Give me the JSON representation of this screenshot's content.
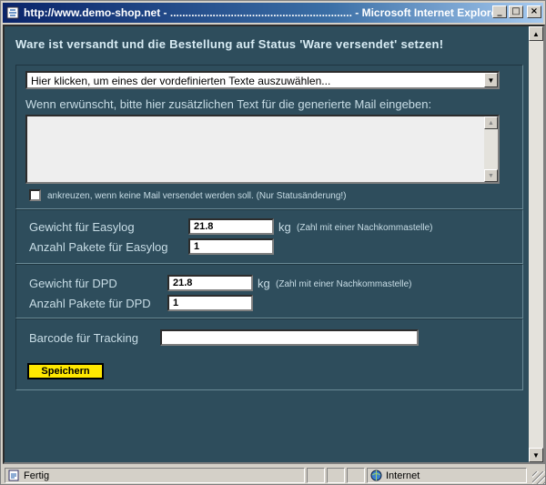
{
  "window": {
    "title": "http://www.demo-shop.net - ............................................................ - Microsoft Internet Explorer",
    "minimize": "_",
    "maximize": "□",
    "close": "×"
  },
  "page": {
    "heading": "Ware ist versandt und die Bestellung auf Status 'Ware versendet' setzen!",
    "template_select": "Hier klicken, um eines der vordefinierten Texte auszuwählen...",
    "extra_text_label": "Wenn erwünscht, bitte hier zusätzlichen Text für die generierte Mail eingeben:",
    "extra_text_value": "",
    "no_mail_label": "ankreuzen, wenn keine Mail versendet werden soll. (Nur Statusänderung!)",
    "no_mail_checked": false,
    "easylog": {
      "weight_label": "Gewicht für Easylog",
      "weight_value": "21.8",
      "unit": "kg",
      "unit_hint": "(Zahl mit einer Nachkommastelle)",
      "packages_label": "Anzahl Pakete für Easylog",
      "packages_value": "1"
    },
    "dpd": {
      "weight_label": "Gewicht für DPD",
      "weight_value": "21.8",
      "unit": "kg",
      "unit_hint": "(Zahl mit einer Nachkommastelle)",
      "packages_label": "Anzahl Pakete für DPD",
      "packages_value": "1"
    },
    "tracking_label": "Barcode für Tracking",
    "tracking_value": "",
    "save_label": "Speichern"
  },
  "statusbar": {
    "status": "Fertig",
    "zone": "Internet"
  },
  "colors": {
    "page_background": "#2e4d5c",
    "save_button": "#ffe800",
    "titlebar": "#0a246a"
  },
  "icons": [
    "ie-icon",
    "minimize-icon",
    "maximize-icon",
    "close-icon",
    "dropdown-arrow-icon",
    "scroll-up-icon",
    "scroll-down-icon",
    "page-icon",
    "globe-icon"
  ]
}
